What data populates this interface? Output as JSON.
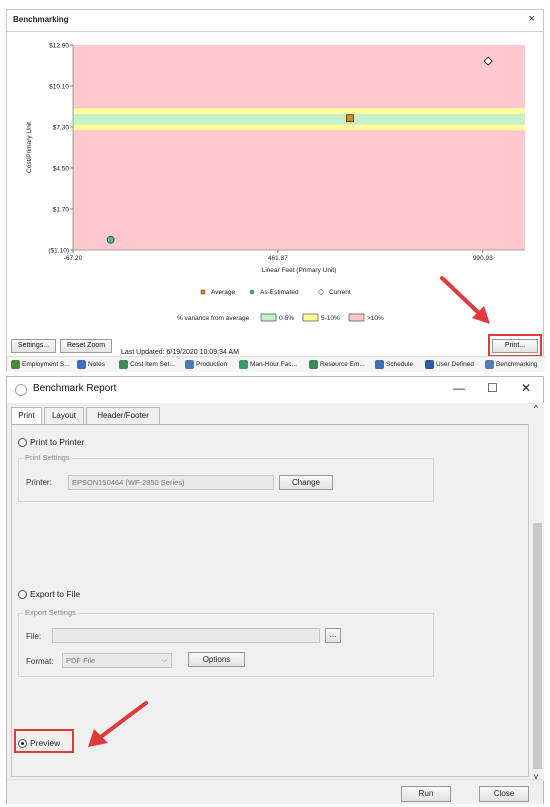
{
  "bench": {
    "title": "Benchmarking",
    "close": "×",
    "settings_label": "Settings...",
    "reset_zoom_label": "Reset Zoom",
    "last_updated": "Last Updated:  6/19/2020 10:09:34 AM",
    "print_label": "Print...",
    "tabs": [
      {
        "label": "Employment S...",
        "icon": "employment-icon",
        "color": "#4a8a3a"
      },
      {
        "label": "Notes",
        "icon": "notes-icon",
        "color": "#3d6fb5"
      },
      {
        "label": "Cost Item Set...",
        "icon": "cost-item-icon",
        "color": "#3a8a5a"
      },
      {
        "label": "Production",
        "icon": "production-icon",
        "color": "#4c7db8"
      },
      {
        "label": "Man-Hour Fac...",
        "icon": "man-hour-icon",
        "color": "#3a9a6a"
      },
      {
        "label": "Resource Em...",
        "icon": "resource-icon",
        "color": "#3a8a5a"
      },
      {
        "label": "Schedule",
        "icon": "schedule-icon",
        "color": "#3d6fb5"
      },
      {
        "label": "User Defined",
        "icon": "user-icon",
        "color": "#2f5aa0"
      },
      {
        "label": "Benchmarking",
        "icon": "benchmark-icon",
        "color": "#5a7ab0"
      }
    ]
  },
  "chart_data": {
    "type": "scatter",
    "xlabel": "Linear Feet (Primary Unit)",
    "ylabel": "Cost/Primary Unit",
    "xlim": [
      -67.2,
      1100
    ],
    "ylim": [
      -1.1,
      12.9
    ],
    "x_ticks": [
      "-67.20",
      "461.87",
      "990.93"
    ],
    "x_tick_values": [
      -67.2,
      461.87,
      990.93
    ],
    "y_ticks": [
      "$12.90",
      "$10.10",
      "$7.30",
      "$4.50",
      "$1.70",
      "($1.10)"
    ],
    "y_tick_values": [
      12.9,
      10.1,
      7.3,
      4.5,
      1.7,
      -1.1
    ],
    "bands": [
      {
        "name": ">10%",
        "from": 7.08,
        "to": 8.58,
        "color": "#ffff99",
        "kind": "yellow"
      },
      {
        "name": "0-5%",
        "from": 7.45,
        "to": 8.2,
        "color": "#c8f0c8",
        "kind": "green"
      }
    ],
    "background_color": "#ffc8cc",
    "series": [
      {
        "name": "Average",
        "marker": "square",
        "color": "#e08a1a",
        "points": [
          [
            648,
            7.9
          ]
        ]
      },
      {
        "name": "As-Estimated",
        "marker": "circle",
        "color": "#40c0b0",
        "points": [
          [
            30,
            -0.4
          ]
        ]
      },
      {
        "name": "Current",
        "marker": "diamond",
        "color": "#ffffff",
        "points": [
          [
            1005,
            11.8
          ]
        ]
      }
    ],
    "legend_caption": "% variance from average",
    "variance_legend": [
      {
        "label": "0-5%",
        "color": "#c8f0c8"
      },
      {
        "label": "5-10%",
        "color": "#ffff99"
      },
      {
        "label": ">10%",
        "color": "#ffc8cc"
      }
    ]
  },
  "report": {
    "title": "Benchmark Report",
    "minimize": "—",
    "maximize": "☐",
    "close": "✕",
    "tabs": [
      "Print",
      "Layout",
      "Header/Footer"
    ],
    "print_to_printer": "Print to Printer",
    "print_settings": "Print Settings",
    "printer_label": "Printer:",
    "printer_value": "EPSON150464 (WF-2850 Series)",
    "change_label": "Change",
    "export_to_file": "Export to File",
    "export_settings": "Export Settings",
    "file_label": "File:",
    "file_value": "",
    "browse_label": "...",
    "format_label": "Format:",
    "format_value": "PDF File",
    "options_label": "Options",
    "preview_label": "Preview",
    "run_label": "Run",
    "close_label": "Close"
  }
}
